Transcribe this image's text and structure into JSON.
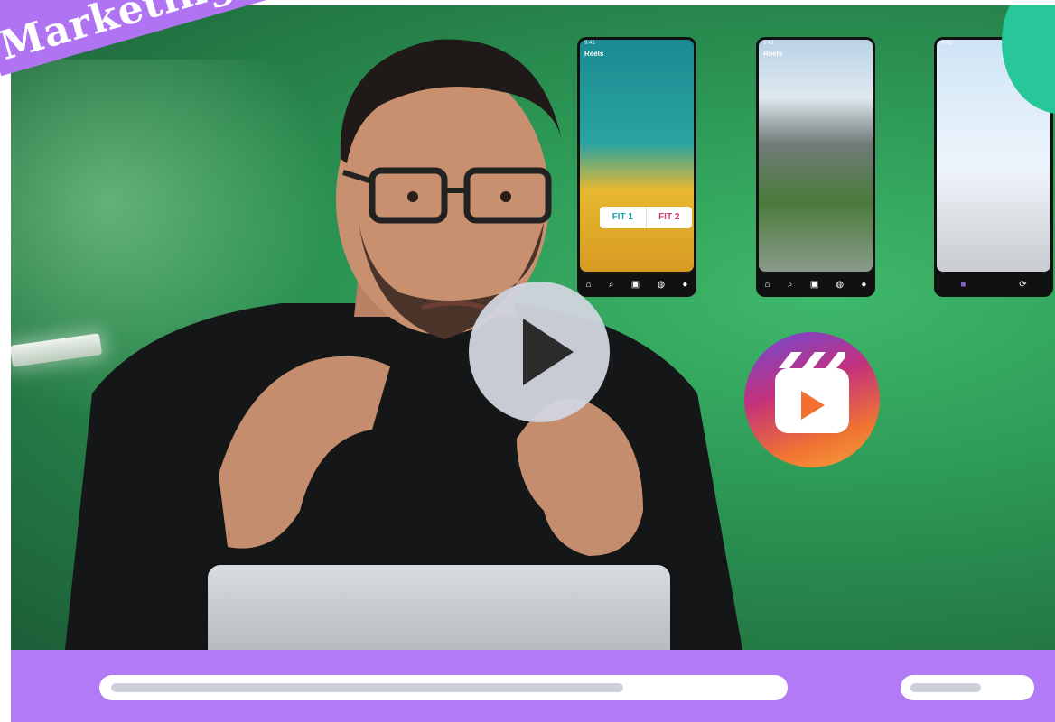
{
  "banner": {
    "text": "Marketing & g"
  },
  "video": {
    "progress_fraction": 0.77,
    "phones": [
      {
        "title": "Reels",
        "time": "9:41",
        "fit_left": "FIT 1",
        "fit_right": "FIT 2"
      },
      {
        "title": "Reels",
        "time": "9:41"
      },
      {
        "title": "",
        "time": "9:41"
      }
    ],
    "icons": {
      "play": "play-icon",
      "reels": "reels-logo-icon"
    }
  },
  "colors": {
    "ribbon": "#b074f3",
    "control_bar": "#b27af5",
    "play_button": "#d1d5de",
    "badge": "#27c79a"
  }
}
